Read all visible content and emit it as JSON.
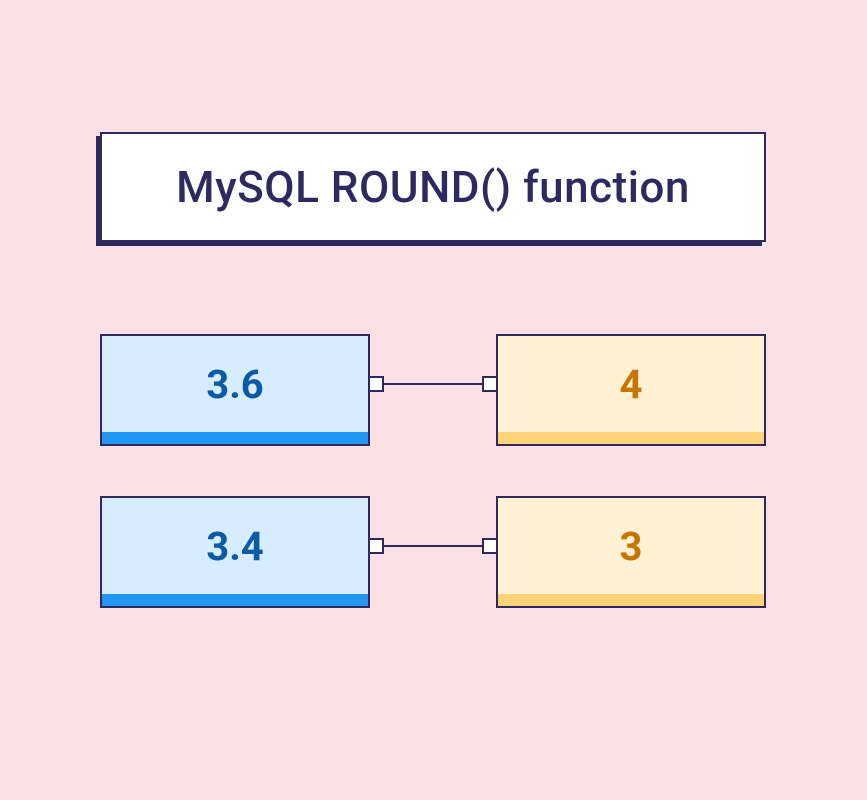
{
  "title": "MySQL ROUND() function",
  "rows": [
    {
      "input": "3.6",
      "output": "4"
    },
    {
      "input": "3.4",
      "output": "3"
    }
  ],
  "colors": {
    "background": "#fbe1e5",
    "border": "#2e2a5f",
    "blue_fill": "#d8ecff",
    "blue_text": "#0b5aa6",
    "blue_accent": "#2296f3",
    "orange_fill": "#fff1d4",
    "orange_text": "#c77400",
    "orange_accent": "#ffd379"
  }
}
